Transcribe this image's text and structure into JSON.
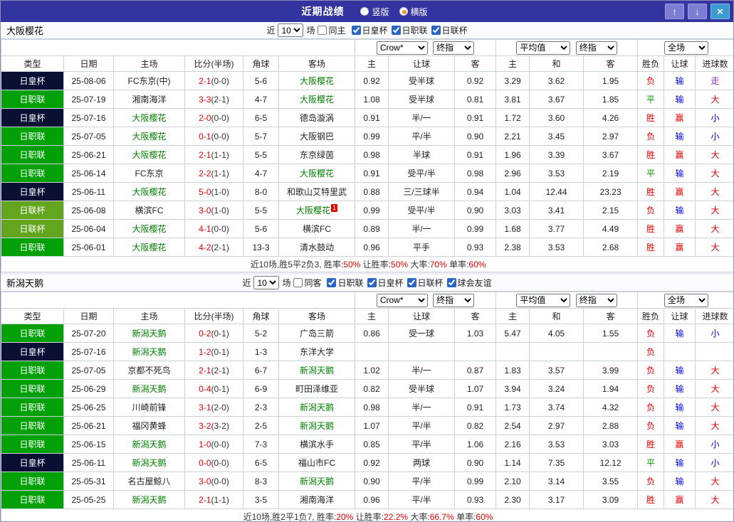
{
  "titlebar": {
    "title": "近期战绩",
    "layout_options": [
      {
        "label": "竖版",
        "selected": false
      },
      {
        "label": "横版",
        "selected": true
      }
    ],
    "buttons": {
      "up": "↑",
      "down": "↓",
      "close": "×"
    }
  },
  "colors": {
    "titlebar_bg": "#3434a0",
    "league_green": "#00a006",
    "league_cup_dark": "#0a1034",
    "league_olive": "#63a51e",
    "focus_team_green": "#008000",
    "score_red": "#e60000",
    "lose_blue": "#0000e6",
    "draw_green": "#009900",
    "push_purple": "#9933cc"
  },
  "columns": [
    "类型",
    "日期",
    "主场",
    "比分(半场)",
    "角球",
    "客场",
    "主",
    "让球",
    "客",
    "主",
    "和",
    "客",
    "胜负",
    "让球",
    "进球数"
  ],
  "sections": [
    {
      "team": "大阪樱花",
      "filter": {
        "near_label": "近",
        "count": "10",
        "games_label": "场",
        "same_label": "同主",
        "leagues": [
          "日皇杯",
          "日职联",
          "日联杯"
        ]
      },
      "dropdowns": {
        "bookmaker": "Crow*",
        "stage": "终指",
        "average": "平均值",
        "avg_stage": "终指",
        "scope": "全场"
      },
      "rows": [
        {
          "type": "日皇杯",
          "type_style": "dark",
          "date": "25-08-06",
          "home": "FC东京(中)",
          "home_focus": false,
          "score": "2-1",
          "half": "(0-0)",
          "corner": "5-6",
          "away": "大阪樱花",
          "away_focus": true,
          "red_card": "",
          "h_home": "0.92",
          "h_line": "受半球",
          "h_away": "0.92",
          "a_home": "3.29",
          "a_draw": "3.62",
          "a_away": "1.95",
          "res": "负",
          "res_color": "red",
          "hres": "输",
          "hres_color": "blue",
          "gres": "走",
          "gres_color": "purple"
        },
        {
          "type": "日职联",
          "type_style": "green",
          "date": "25-07-19",
          "home": "湘南海洋",
          "home_focus": false,
          "score": "3-3",
          "half": "(2-1)",
          "corner": "4-7",
          "away": "大阪樱花",
          "away_focus": true,
          "red_card": "",
          "h_home": "1.08",
          "h_line": "受半球",
          "h_away": "0.81",
          "a_home": "3.81",
          "a_draw": "3.67",
          "a_away": "1.85",
          "res": "平",
          "res_color": "green",
          "hres": "输",
          "hres_color": "blue",
          "gres": "大",
          "gres_color": "red"
        },
        {
          "type": "日皇杯",
          "type_style": "dark",
          "date": "25-07-16",
          "home": "大阪樱花",
          "home_focus": true,
          "score": "2-0",
          "half": "(0-0)",
          "corner": "6-5",
          "away": "德岛漩涡",
          "away_focus": false,
          "red_card": "",
          "h_home": "0.91",
          "h_line": "半/一",
          "h_away": "0.91",
          "a_home": "1.72",
          "a_draw": "3.60",
          "a_away": "4.26",
          "res": "胜",
          "res_color": "red",
          "hres": "赢",
          "hres_color": "red",
          "gres": "小",
          "gres_color": "blue"
        },
        {
          "type": "日职联",
          "type_style": "green",
          "date": "25-07-05",
          "home": "大阪樱花",
          "home_focus": true,
          "score": "0-1",
          "half": "(0-0)",
          "corner": "5-7",
          "away": "大阪钢巴",
          "away_focus": false,
          "red_card": "",
          "h_home": "0.99",
          "h_line": "平/半",
          "h_away": "0.90",
          "a_home": "2.21",
          "a_draw": "3.45",
          "a_away": "2.97",
          "res": "负",
          "res_color": "red",
          "hres": "输",
          "hres_color": "blue",
          "gres": "小",
          "gres_color": "blue"
        },
        {
          "type": "日职联",
          "type_style": "green",
          "date": "25-06-21",
          "home": "大阪樱花",
          "home_focus": true,
          "score": "2-1",
          "half": "(1-1)",
          "corner": "5-5",
          "away": "东京绿茵",
          "away_focus": false,
          "red_card": "",
          "h_home": "0.98",
          "h_line": "半球",
          "h_away": "0.91",
          "a_home": "1.96",
          "a_draw": "3.39",
          "a_away": "3.67",
          "res": "胜",
          "res_color": "red",
          "hres": "赢",
          "hres_color": "red",
          "gres": "大",
          "gres_color": "red"
        },
        {
          "type": "日职联",
          "type_style": "green",
          "date": "25-06-14",
          "home": "FC东京",
          "home_focus": false,
          "score": "2-2",
          "half": "(1-1)",
          "corner": "4-7",
          "away": "大阪樱花",
          "away_focus": true,
          "red_card": "",
          "h_home": "0.91",
          "h_line": "受平/半",
          "h_away": "0.98",
          "a_home": "2.96",
          "a_draw": "3.53",
          "a_away": "2.19",
          "res": "平",
          "res_color": "green",
          "hres": "输",
          "hres_color": "blue",
          "gres": "大",
          "gres_color": "red"
        },
        {
          "type": "日皇杯",
          "type_style": "dark",
          "date": "25-06-11",
          "home": "大阪樱花",
          "home_focus": true,
          "score": "5-0",
          "half": "(1-0)",
          "corner": "8-0",
          "away": "和歌山艾特里武",
          "away_focus": false,
          "red_card": "",
          "h_home": "0.88",
          "h_line": "三/三球半",
          "h_away": "0.94",
          "a_home": "1.04",
          "a_draw": "12.44",
          "a_away": "23.23",
          "res": "胜",
          "res_color": "red",
          "hres": "赢",
          "hres_color": "red",
          "gres": "大",
          "gres_color": "red"
        },
        {
          "type": "日联杯",
          "type_style": "olive",
          "date": "25-06-08",
          "home": "横滨FC",
          "home_focus": false,
          "score": "3-0",
          "half": "(1-0)",
          "corner": "5-5",
          "away": "大阪樱花",
          "away_focus": true,
          "red_card": "1",
          "h_home": "0.99",
          "h_line": "受平/半",
          "h_away": "0.90",
          "a_home": "3.03",
          "a_draw": "3.41",
          "a_away": "2.15",
          "res": "负",
          "res_color": "red",
          "hres": "输",
          "hres_color": "blue",
          "gres": "大",
          "gres_color": "red"
        },
        {
          "type": "日联杯",
          "type_style": "olive",
          "date": "25-06-04",
          "home": "大阪樱花",
          "home_focus": true,
          "score": "4-1",
          "half": "(0-0)",
          "corner": "5-6",
          "away": "横滨FC",
          "away_focus": false,
          "red_card": "",
          "h_home": "0.89",
          "h_line": "半/一",
          "h_away": "0.99",
          "a_home": "1.68",
          "a_draw": "3.77",
          "a_away": "4.49",
          "res": "胜",
          "res_color": "red",
          "hres": "赢",
          "hres_color": "red",
          "gres": "大",
          "gres_color": "red"
        },
        {
          "type": "日职联",
          "type_style": "green",
          "date": "25-06-01",
          "home": "大阪樱花",
          "home_focus": true,
          "score": "4-2",
          "half": "(2-1)",
          "corner": "13-3",
          "away": "清水鼓动",
          "away_focus": false,
          "red_card": "",
          "h_home": "0.96",
          "h_line": "平手",
          "h_away": "0.93",
          "a_home": "2.38",
          "a_draw": "3.53",
          "a_away": "2.68",
          "res": "胜",
          "res_color": "red",
          "hres": "赢",
          "hres_color": "red",
          "gres": "大",
          "gres_color": "red"
        }
      ],
      "summary": [
        {
          "text": "近10场,胜5平2负3, 胜率:",
          "color": "dark"
        },
        {
          "text": "50%",
          "color": "red"
        },
        {
          "text": " 让胜率:",
          "color": "dark"
        },
        {
          "text": "50%",
          "color": "red"
        },
        {
          "text": " 大率:",
          "color": "dark"
        },
        {
          "text": "70%",
          "color": "red"
        },
        {
          "text": " 单率:",
          "color": "dark"
        },
        {
          "text": "60%",
          "color": "red"
        }
      ]
    },
    {
      "team": "新潟天鹅",
      "filter": {
        "near_label": "近",
        "count": "10",
        "games_label": "场",
        "same_label": "同客",
        "leagues": [
          "日职联",
          "日皇杯",
          "日联杯",
          "球会友谊"
        ]
      },
      "dropdowns": {
        "bookmaker": "Crow*",
        "stage": "终指",
        "average": "平均值",
        "avg_stage": "终指",
        "scope": "全场"
      },
      "rows": [
        {
          "type": "日职联",
          "type_style": "green",
          "date": "25-07-20",
          "home": "新潟天鹅",
          "home_focus": true,
          "score": "0-2",
          "half": "(0-1)",
          "corner": "5-2",
          "away": "广岛三箭",
          "away_focus": false,
          "red_card": "",
          "h_home": "0.86",
          "h_line": "受一球",
          "h_away": "1.03",
          "a_home": "5.47",
          "a_draw": "4.05",
          "a_away": "1.55",
          "res": "负",
          "res_color": "red",
          "hres": "输",
          "hres_color": "blue",
          "gres": "小",
          "gres_color": "blue"
        },
        {
          "type": "日皇杯",
          "type_style": "dark",
          "date": "25-07-16",
          "home": "新潟天鹅",
          "home_focus": true,
          "score": "1-2",
          "half": "(0-1)",
          "corner": "1-3",
          "away": "东洋大学",
          "away_focus": false,
          "red_card": "",
          "h_home": "",
          "h_line": "",
          "h_away": "",
          "a_home": "",
          "a_draw": "",
          "a_away": "",
          "res": "负",
          "res_color": "red",
          "hres": "",
          "hres_color": "",
          "gres": "",
          "gres_color": ""
        },
        {
          "type": "日职联",
          "type_style": "green",
          "date": "25-07-05",
          "home": "京都不死鸟",
          "home_focus": false,
          "score": "2-1",
          "half": "(2-1)",
          "corner": "6-7",
          "away": "新潟天鹅",
          "away_focus": true,
          "red_card": "",
          "h_home": "1.02",
          "h_line": "半/一",
          "h_away": "0.87",
          "a_home": "1.83",
          "a_draw": "3.57",
          "a_away": "3.99",
          "res": "负",
          "res_color": "red",
          "hres": "输",
          "hres_color": "blue",
          "gres": "大",
          "gres_color": "red"
        },
        {
          "type": "日职联",
          "type_style": "green",
          "date": "25-06-29",
          "home": "新潟天鹅",
          "home_focus": true,
          "score": "0-4",
          "half": "(0-1)",
          "corner": "6-9",
          "away": "町田泽维亚",
          "away_focus": false,
          "red_card": "",
          "h_home": "0.82",
          "h_line": "受半球",
          "h_away": "1.07",
          "a_home": "3.94",
          "a_draw": "3.24",
          "a_away": "1.94",
          "res": "负",
          "res_color": "red",
          "hres": "输",
          "hres_color": "blue",
          "gres": "大",
          "gres_color": "red"
        },
        {
          "type": "日职联",
          "type_style": "green",
          "date": "25-06-25",
          "home": "川崎前锋",
          "home_focus": false,
          "score": "3-1",
          "half": "(2-0)",
          "corner": "2-3",
          "away": "新潟天鹅",
          "away_focus": true,
          "red_card": "",
          "h_home": "0.98",
          "h_line": "半/一",
          "h_away": "0.91",
          "a_home": "1.73",
          "a_draw": "3.74",
          "a_away": "4.32",
          "res": "负",
          "res_color": "red",
          "hres": "输",
          "hres_color": "blue",
          "gres": "大",
          "gres_color": "red"
        },
        {
          "type": "日职联",
          "type_style": "green",
          "date": "25-06-21",
          "home": "福冈黄蜂",
          "home_focus": false,
          "score": "3-2",
          "half": "(3-2)",
          "corner": "2-5",
          "away": "新潟天鹅",
          "away_focus": true,
          "red_card": "",
          "h_home": "1.07",
          "h_line": "平/半",
          "h_away": "0.82",
          "a_home": "2.54",
          "a_draw": "2.97",
          "a_away": "2.88",
          "res": "负",
          "res_color": "red",
          "hres": "输",
          "hres_color": "blue",
          "gres": "大",
          "gres_color": "red"
        },
        {
          "type": "日职联",
          "type_style": "green",
          "date": "25-06-15",
          "home": "新潟天鹅",
          "home_focus": true,
          "score": "1-0",
          "half": "(0-0)",
          "corner": "7-3",
          "away": "横滨水手",
          "away_focus": false,
          "red_card": "",
          "h_home": "0.85",
          "h_line": "平/半",
          "h_away": "1.06",
          "a_home": "2.16",
          "a_draw": "3.53",
          "a_away": "3.03",
          "res": "胜",
          "res_color": "red",
          "hres": "赢",
          "hres_color": "red",
          "gres": "小",
          "gres_color": "blue"
        },
        {
          "type": "日皇杯",
          "type_style": "dark",
          "date": "25-06-11",
          "home": "新潟天鹅",
          "home_focus": true,
          "score": "0-0",
          "half": "(0-0)",
          "corner": "6-5",
          "away": "福山市FC",
          "away_focus": false,
          "red_card": "",
          "h_home": "0.92",
          "h_line": "两球",
          "h_away": "0.90",
          "a_home": "1.14",
          "a_draw": "7.35",
          "a_away": "12.12",
          "res": "平",
          "res_color": "green",
          "hres": "输",
          "hres_color": "blue",
          "gres": "小",
          "gres_color": "blue"
        },
        {
          "type": "日职联",
          "type_style": "green",
          "date": "25-05-31",
          "home": "名古屋鲸八",
          "home_focus": false,
          "score": "3-0",
          "half": "(0-0)",
          "corner": "8-3",
          "away": "新潟天鹅",
          "away_focus": true,
          "red_card": "",
          "h_home": "0.90",
          "h_line": "平/半",
          "h_away": "0.99",
          "a_home": "2.10",
          "a_draw": "3.14",
          "a_away": "3.55",
          "res": "负",
          "res_color": "red",
          "hres": "输",
          "hres_color": "blue",
          "gres": "大",
          "gres_color": "red"
        },
        {
          "type": "日职联",
          "type_style": "green",
          "date": "25-05-25",
          "home": "新潟天鹅",
          "home_focus": true,
          "score": "2-1",
          "half": "(1-1)",
          "corner": "3-5",
          "away": "湘南海洋",
          "away_focus": false,
          "red_card": "",
          "h_home": "0.96",
          "h_line": "平/半",
          "h_away": "0.93",
          "a_home": "2.30",
          "a_draw": "3.17",
          "a_away": "3.09",
          "res": "胜",
          "res_color": "red",
          "hres": "赢",
          "hres_color": "red",
          "gres": "大",
          "gres_color": "red"
        }
      ],
      "summary": [
        {
          "text": "近10场,胜2平1负7, 胜率:",
          "color": "dark"
        },
        {
          "text": "20%",
          "color": "red"
        },
        {
          "text": " 让胜率:",
          "color": "dark"
        },
        {
          "text": "22.2%",
          "color": "red"
        },
        {
          "text": " 大率:",
          "color": "dark"
        },
        {
          "text": "66.7%",
          "color": "red"
        },
        {
          "text": " 单率:",
          "color": "dark"
        },
        {
          "text": "60%",
          "color": "red"
        }
      ]
    }
  ]
}
